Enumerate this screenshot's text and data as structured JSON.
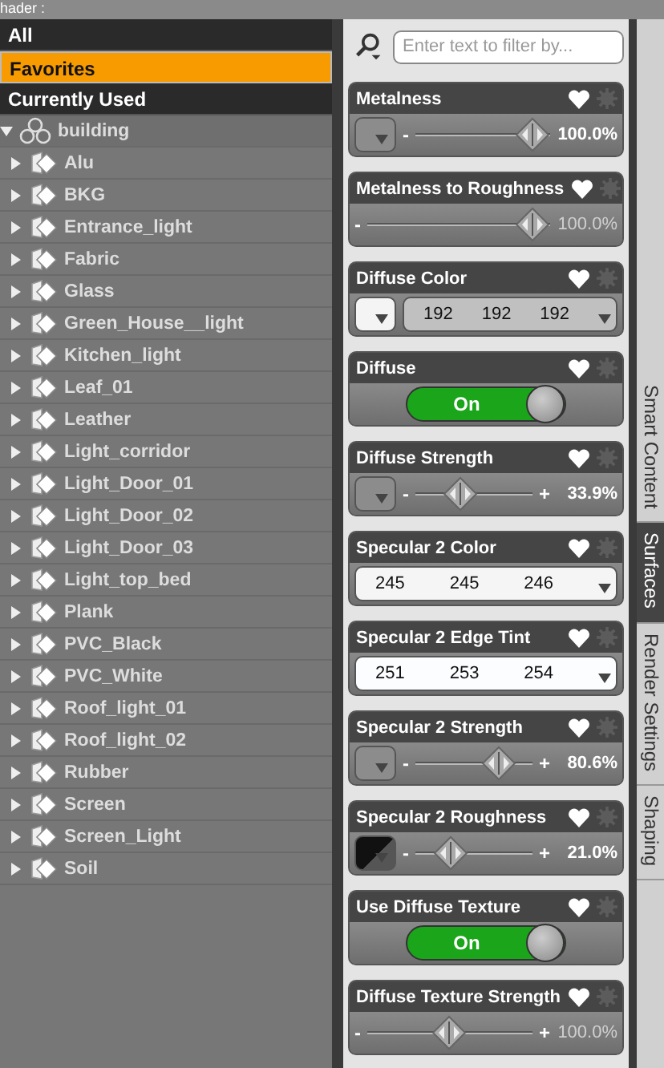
{
  "header": {
    "title": "hader :"
  },
  "filters": [
    {
      "label": "All",
      "selected": false
    },
    {
      "label": "Favorites",
      "selected": true
    },
    {
      "label": "Currently Used",
      "selected": false
    }
  ],
  "tree": {
    "label": "building",
    "expanded": true,
    "children": [
      {
        "label": "Alu",
        "expanded": false
      },
      {
        "label": "BKG",
        "expanded": false
      },
      {
        "label": "Entrance_light",
        "expanded": false
      },
      {
        "label": "Fabric",
        "expanded": false
      },
      {
        "label": "Glass",
        "expanded": false
      },
      {
        "label": "Green_House__light",
        "expanded": false
      },
      {
        "label": "Kitchen_light",
        "expanded": false
      },
      {
        "label": "Leaf_01",
        "expanded": false
      },
      {
        "label": "Leather",
        "expanded": false
      },
      {
        "label": "Light_corridor",
        "expanded": false
      },
      {
        "label": "Light_Door_01",
        "expanded": false
      },
      {
        "label": "Light_Door_02",
        "expanded": false
      },
      {
        "label": "Light_Door_03",
        "expanded": false
      },
      {
        "label": "Light_top_bed",
        "expanded": false
      },
      {
        "label": "Plank",
        "expanded": false
      },
      {
        "label": "PVC_Black",
        "expanded": false
      },
      {
        "label": "PVC_White",
        "expanded": false
      },
      {
        "label": "Roof_light_01",
        "expanded": false
      },
      {
        "label": "Roof_light_02",
        "expanded": false
      },
      {
        "label": "Rubber",
        "expanded": false
      },
      {
        "label": "Screen",
        "expanded": false
      },
      {
        "label": "Screen_Light",
        "expanded": false
      },
      {
        "label": "Soil",
        "expanded": false
      }
    ]
  },
  "search": {
    "placeholder": "Enter text to filter by..."
  },
  "properties": [
    {
      "kind": "slider",
      "title": "Metalness",
      "favorite": true,
      "map_button": {
        "kind": "plain"
      },
      "minus": "-",
      "level": 1,
      "value": "100.0%",
      "value_dimmed": false
    },
    {
      "kind": "slider",
      "title": "Metalness to Roughness",
      "favorite": true,
      "minus": "-",
      "level": 1,
      "value": "100.0%",
      "value_dimmed": true
    },
    {
      "kind": "color",
      "title": "Diffuse Color",
      "favorite": true,
      "map_button": {
        "kind": "white"
      },
      "values": [
        "192",
        "192",
        "192"
      ]
    },
    {
      "kind": "toggle",
      "title": "Diffuse",
      "favorite": true,
      "label": "On",
      "on": true
    },
    {
      "kind": "slider",
      "title": "Diffuse Strength",
      "favorite": true,
      "map_button": {
        "kind": "plain"
      },
      "minus": "-",
      "plus": "+",
      "level": 0.339,
      "value": "33.9%",
      "value_dimmed": false
    },
    {
      "kind": "color",
      "title": "Specular 2 Color",
      "favorite": true,
      "values": [
        "245",
        "245",
        "246"
      ]
    },
    {
      "kind": "color",
      "title": "Specular 2 Edge Tint",
      "favorite": true,
      "values": [
        "251",
        "253",
        "254"
      ]
    },
    {
      "kind": "slider",
      "title": "Specular 2 Strength",
      "favorite": true,
      "map_button": {
        "kind": "plain"
      },
      "minus": "-",
      "plus": "+",
      "level": 0.806,
      "value": "80.6%",
      "value_dimmed": false
    },
    {
      "kind": "slider",
      "title": "Specular 2 Roughness",
      "favorite": true,
      "map_button": {
        "kind": "texture"
      },
      "minus": "-",
      "plus": "+",
      "level": 0.21,
      "value": "21.0%",
      "value_dimmed": false
    },
    {
      "kind": "toggle",
      "title": "Use Diffuse Texture",
      "favorite": true,
      "label": "On",
      "on": true
    },
    {
      "kind": "slider",
      "title": "Diffuse Texture Strength",
      "favorite": true,
      "minus": "-",
      "plus": "+",
      "level": 0.5,
      "value": "100.0%",
      "value_dimmed": true
    }
  ],
  "side_tabs": [
    {
      "label": "Smart Content",
      "selected": false
    },
    {
      "label": "Surfaces",
      "selected": true
    },
    {
      "label": "Render Settings",
      "selected": false
    },
    {
      "label": "Shaping",
      "selected": false
    }
  ]
}
